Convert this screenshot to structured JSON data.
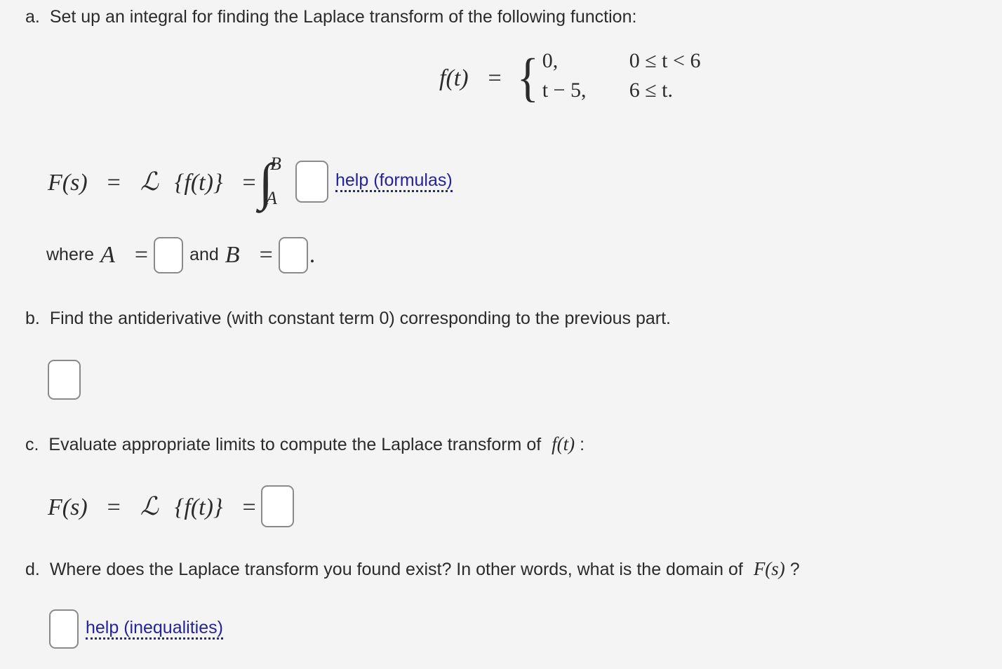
{
  "colors": {
    "background": "#f4f4f4",
    "text": "#2b2b2b",
    "link": "#23239e",
    "box_border": "#8a8a8a",
    "box_fill": "#ffffff"
  },
  "parts": {
    "a": {
      "marker": "a.",
      "prompt": "Set up an integral for finding the Laplace transform of the following function:",
      "piecewise": {
        "lhs": "f(t)",
        "equals": "=",
        "rows": [
          {
            "expr": "0,",
            "condition": "0 ≤ t < 6"
          },
          {
            "expr": "t − 5,",
            "condition": "6 ≤ t."
          }
        ]
      },
      "integral_line": {
        "lhs_1": "F(s)",
        "eq_1": "=",
        "operator": "ℒ",
        "operand": "{f(t)}",
        "eq_2": "=",
        "integral_symbol": "∫",
        "upper_limit": "B",
        "lower_limit": "A",
        "answer_box_value": "",
        "help_label": "help (formulas)"
      },
      "where_line": {
        "where_text": "where",
        "var_a": "A",
        "eq_a": "=",
        "a_box_value": "",
        "and_text": "and",
        "var_b": "B",
        "eq_b": "=",
        "b_box_value": "",
        "period": "."
      }
    },
    "b": {
      "marker": "b.",
      "prompt": "Find the antiderivative (with constant term 0) corresponding to the previous part.",
      "answer_box_value": ""
    },
    "c": {
      "marker": "c.",
      "prompt_pre": "Evaluate appropriate limits to compute the Laplace transform of",
      "prompt_math": "f(t)",
      "prompt_post": ":",
      "equation": {
        "lhs_1": "F(s)",
        "eq_1": "=",
        "operator": "ℒ",
        "operand": "{f(t)}",
        "eq_2": "=",
        "answer_box_value": ""
      }
    },
    "d": {
      "marker": "d.",
      "prompt_pre": "Where does the Laplace transform you found exist? In other words, what is the domain of",
      "prompt_math": "F(s)",
      "prompt_post": "?",
      "answer_box_value": "",
      "help_label": "help (inequalities)"
    }
  }
}
